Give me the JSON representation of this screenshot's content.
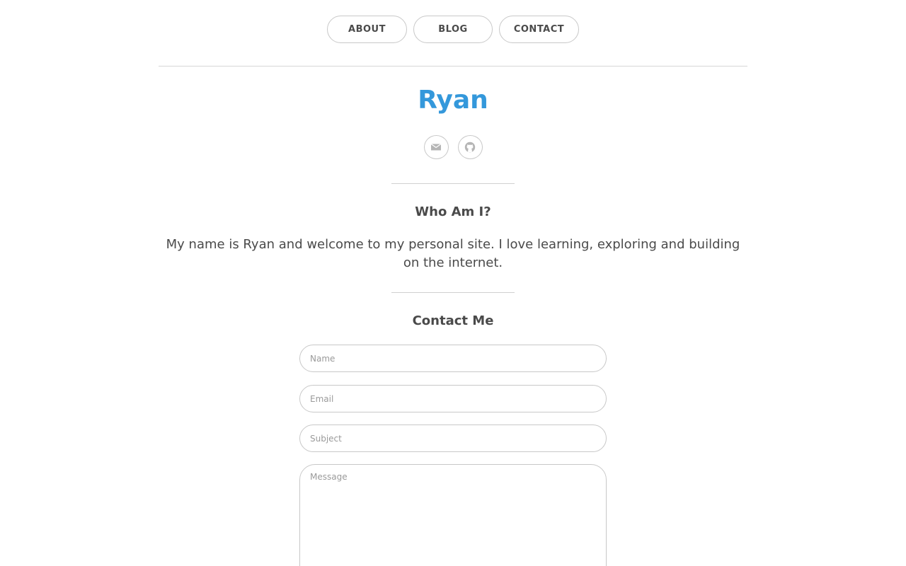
{
  "nav": {
    "items": [
      {
        "label": "ABOUT"
      },
      {
        "label": "BLOG"
      },
      {
        "label": "CONTACT"
      }
    ]
  },
  "header": {
    "title": "Ryan",
    "title_color": "#3498db",
    "social_icons": [
      "envelope-icon",
      "github-icon"
    ]
  },
  "about": {
    "heading": "Who Am I?",
    "text": "My name is Ryan and welcome to my personal site. I love learning, exploring and building on the internet."
  },
  "contact": {
    "heading": "Contact Me",
    "name_placeholder": "Name",
    "email_placeholder": "Email",
    "subject_placeholder": "Subject",
    "message_placeholder": "Message"
  }
}
